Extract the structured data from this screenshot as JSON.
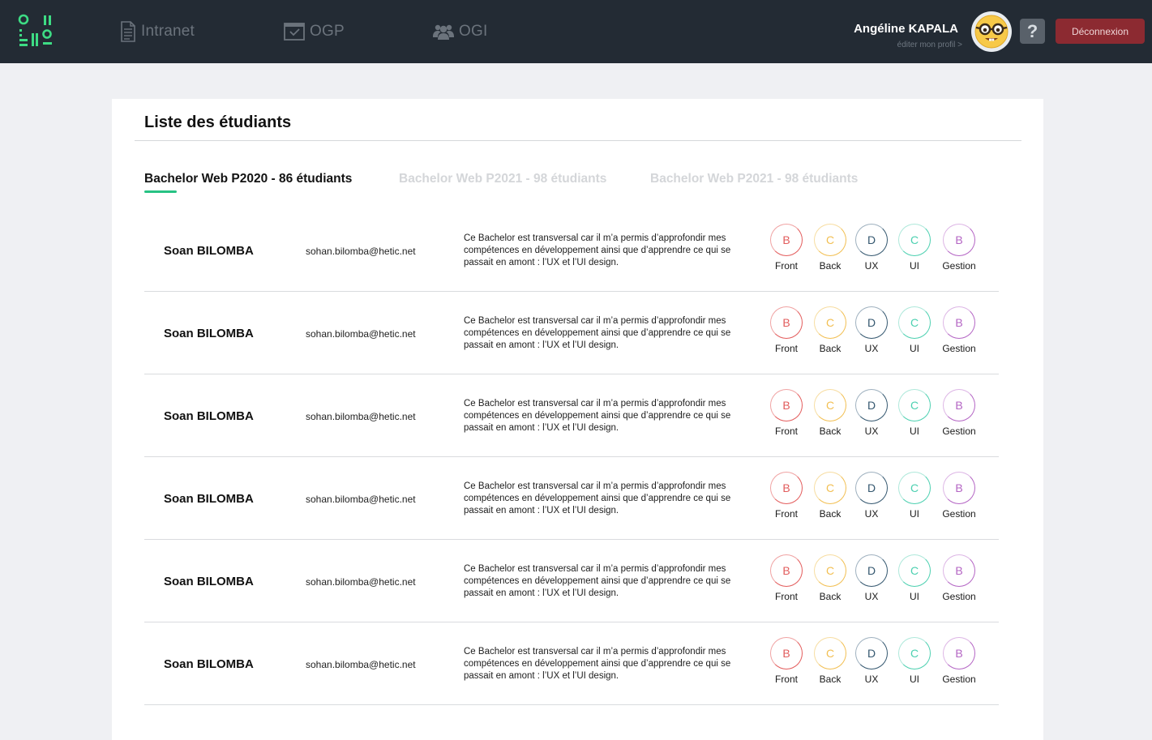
{
  "header": {
    "nav": [
      {
        "label": "Intranet",
        "icon": "document-icon"
      },
      {
        "label": "OGP",
        "icon": "calendar-window-icon"
      },
      {
        "label": "OGI",
        "icon": "users-group-icon"
      }
    ],
    "user": {
      "name": "Angéline KAPALA",
      "edit_profile": "éditer mon profil >",
      "avatar": "nerd-face-emoji"
    },
    "help_label": "?",
    "logout_label": "Déconnexion",
    "colors": {
      "background": "#232b34",
      "accent": "#3ddc84",
      "logout": "#8c2a31"
    }
  },
  "main": {
    "title": "Liste des étudiants",
    "tabs": [
      {
        "label": "Bachelor Web P2020 - 86 étudiants",
        "active": true
      },
      {
        "label": "Bachelor Web P2021 - 98 étudiants",
        "active": false
      },
      {
        "label": "Bachelor Web P2021 - 98 étudiants",
        "active": false
      }
    ],
    "students": [
      {
        "name": "Soan BILOMBA",
        "email": "sohan.bilomba@hetic.net",
        "description": "Ce Bachelor est transversal car il m’a permis d’approfondir mes compétences en développement ainsi que d’apprendre ce qui se passait en amont : l’UX et l’UI design.",
        "grades": {
          "front": "B",
          "back": "C",
          "ux": "D",
          "ui": "C",
          "gestion": "B"
        }
      },
      {
        "name": "Soan BILOMBA",
        "email": "sohan.bilomba@hetic.net",
        "description": "Ce Bachelor est transversal car il m’a permis d’approfondir mes compétences en développement ainsi que d’apprendre ce qui se passait en amont : l’UX et l’UI design.",
        "grades": {
          "front": "B",
          "back": "C",
          "ux": "D",
          "ui": "C",
          "gestion": "B"
        }
      },
      {
        "name": "Soan BILOMBA",
        "email": "sohan.bilomba@hetic.net",
        "description": "Ce Bachelor est transversal car il m’a permis d’approfondir mes compétences en développement ainsi que d’apprendre ce qui se passait en amont : l’UX et l’UI design.",
        "grades": {
          "front": "B",
          "back": "C",
          "ux": "D",
          "ui": "C",
          "gestion": "B"
        }
      },
      {
        "name": "Soan BILOMBA",
        "email": "sohan.bilomba@hetic.net",
        "description": "Ce Bachelor est transversal car il m’a permis d’approfondir mes compétences en développement ainsi que d’apprendre ce qui se passait en amont : l’UX et l’UI design.",
        "grades": {
          "front": "B",
          "back": "C",
          "ux": "D",
          "ui": "C",
          "gestion": "B"
        }
      },
      {
        "name": "Soan BILOMBA",
        "email": "sohan.bilomba@hetic.net",
        "description": "Ce Bachelor est transversal car il m’a permis d’approfondir mes compétences en développement ainsi que d’apprendre ce qui se passait en amont : l’UX et l’UI design.",
        "grades": {
          "front": "B",
          "back": "C",
          "ux": "D",
          "ui": "C",
          "gestion": "B"
        }
      },
      {
        "name": "Soan BILOMBA",
        "email": "sohan.bilomba@hetic.net",
        "description": "Ce Bachelor est transversal car il m’a permis d’approfondir mes compétences en développement ainsi que d’apprendre ce qui se passait en amont : l’UX et l’UI design.",
        "grades": {
          "front": "B",
          "back": "C",
          "ux": "D",
          "ui": "C",
          "gestion": "B"
        }
      }
    ],
    "grade_labels": {
      "front": "Front",
      "back": "Back",
      "ux": "UX",
      "ui": "UI",
      "gestion": "Gestion"
    },
    "grade_colors": {
      "front": "#e25c5c",
      "back": "#f2bf52",
      "ux": "#34576f",
      "ui": "#4cd0b0",
      "gestion": "#b465c4"
    }
  }
}
